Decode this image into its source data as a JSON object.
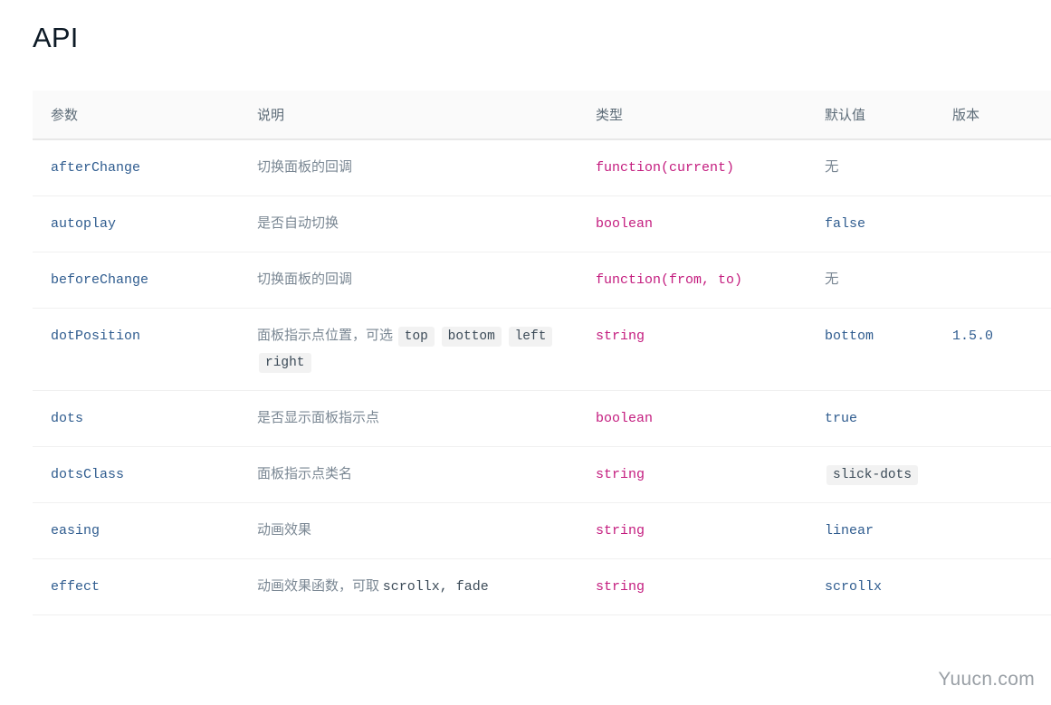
{
  "page": {
    "title": "API",
    "watermark": "Yuucn.com"
  },
  "colors": {
    "title": "#0d1a26",
    "param": "#2f5c8f",
    "description": "#7a8793",
    "type": "#c41d7f",
    "default": "#2f5c8f",
    "header_bg": "#fafafa",
    "header_text": "#5c6b77",
    "row_border": "#f0f0f0",
    "header_border": "#e8e8e8",
    "chip_bg": "#f2f2f2",
    "watermark": "#9aa0a6"
  },
  "table": {
    "headers": [
      {
        "label": "参数",
        "name": "param"
      },
      {
        "label": "说明",
        "name": "description"
      },
      {
        "label": "类型",
        "name": "type"
      },
      {
        "label": "默认值",
        "name": "default"
      },
      {
        "label": "版本",
        "name": "version"
      }
    ],
    "rows": [
      {
        "param": "afterChange",
        "desc_text": "切换面板的回调",
        "desc_chips": [],
        "desc_trailing": "",
        "type": "function(current)",
        "default": "无",
        "default_is_chip": false,
        "default_plain": true,
        "version": ""
      },
      {
        "param": "autoplay",
        "desc_text": "是否自动切换",
        "desc_chips": [],
        "desc_trailing": "",
        "type": "boolean",
        "default": "false",
        "default_is_chip": false,
        "default_plain": false,
        "version": ""
      },
      {
        "param": "beforeChange",
        "desc_text": "切换面板的回调",
        "desc_chips": [],
        "desc_trailing": "",
        "type": "function(from, to)",
        "default": "无",
        "default_is_chip": false,
        "default_plain": true,
        "version": ""
      },
      {
        "param": "dotPosition",
        "desc_text": "面板指示点位置，可选",
        "desc_chips": [
          "top",
          "bottom",
          "left",
          "right"
        ],
        "desc_trailing": "",
        "type": "string",
        "default": "bottom",
        "default_is_chip": false,
        "default_plain": false,
        "version": "1.5.0"
      },
      {
        "param": "dots",
        "desc_text": "是否显示面板指示点",
        "desc_chips": [],
        "desc_trailing": "",
        "type": "boolean",
        "default": "true",
        "default_is_chip": false,
        "default_plain": false,
        "version": ""
      },
      {
        "param": "dotsClass",
        "desc_text": "面板指示点类名",
        "desc_chips": [],
        "desc_trailing": "",
        "type": "string",
        "default": "slick-dots",
        "default_is_chip": true,
        "default_plain": false,
        "version": ""
      },
      {
        "param": "easing",
        "desc_text": "动画效果",
        "desc_chips": [],
        "desc_trailing": "",
        "type": "string",
        "default": "linear",
        "default_is_chip": false,
        "default_plain": false,
        "version": ""
      },
      {
        "param": "effect",
        "desc_text": "动画效果函数，可取",
        "desc_chips": [],
        "desc_trailing": "scrollx, fade",
        "type": "string",
        "default": "scrollx",
        "default_is_chip": false,
        "default_plain": false,
        "version": ""
      }
    ]
  }
}
